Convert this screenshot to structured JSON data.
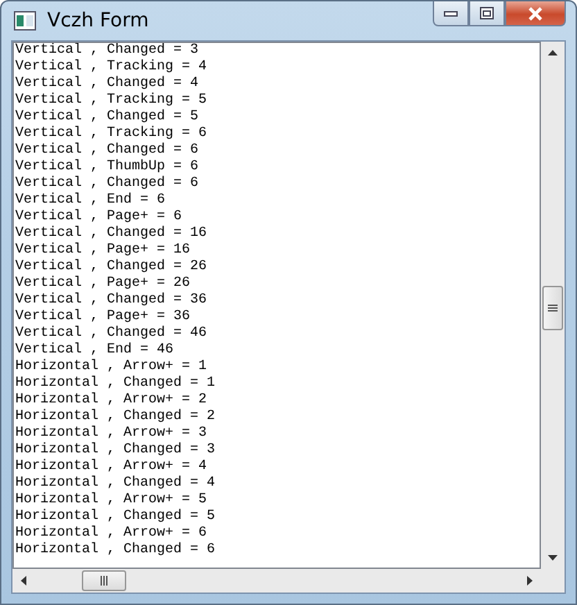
{
  "window": {
    "title": "Vczh Form"
  },
  "log_lines": [
    "Vertical , Changed = 3",
    "Vertical , Tracking = 4",
    "Vertical , Changed = 4",
    "Vertical , Tracking = 5",
    "Vertical , Changed = 5",
    "Vertical , Tracking = 6",
    "Vertical , Changed = 6",
    "Vertical , ThumbUp = 6",
    "Vertical , Changed = 6",
    "Vertical , End = 6",
    "Vertical , Page+ = 6",
    "Vertical , Changed = 16",
    "Vertical , Page+ = 16",
    "Vertical , Changed = 26",
    "Vertical , Page+ = 26",
    "Vertical , Changed = 36",
    "Vertical , Page+ = 36",
    "Vertical , Changed = 46",
    "Vertical , End = 46",
    "Horizontal , Arrow+ = 1",
    "Horizontal , Changed = 1",
    "Horizontal , Arrow+ = 2",
    "Horizontal , Changed = 2",
    "Horizontal , Arrow+ = 3",
    "Horizontal , Changed = 3",
    "Horizontal , Arrow+ = 4",
    "Horizontal , Changed = 4",
    "Horizontal , Arrow+ = 5",
    "Horizontal , Changed = 5",
    "Horizontal , Arrow+ = 6",
    "Horizontal , Changed = 6"
  ]
}
